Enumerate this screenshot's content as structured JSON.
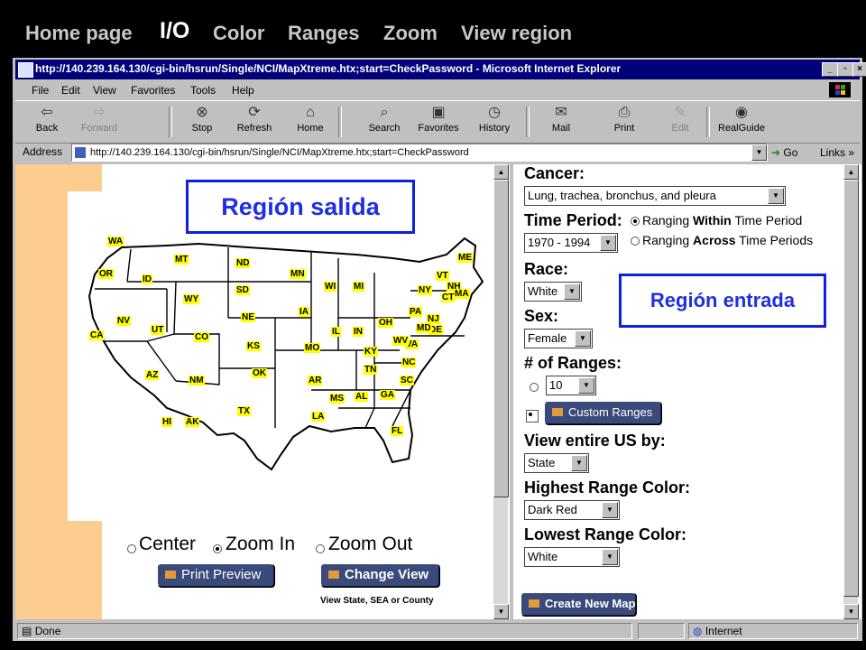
{
  "nav": {
    "items": [
      "Home page",
      "I/O",
      "Color",
      "Ranges",
      "Zoom",
      "View region"
    ],
    "active": "I/O"
  },
  "browser": {
    "title": "http://140.239.164.130/cgi-bin/hsrun/Single/NCI/MapXtreme.htx;start=CheckPassword - Microsoft Internet Explorer",
    "menu": [
      "File",
      "Edit",
      "View",
      "Favorites",
      "Tools",
      "Help"
    ],
    "toolbar": [
      {
        "label": "Back",
        "icon": "back-arrow-icon",
        "glyph": "⇦",
        "enabled": true
      },
      {
        "label": "Forward",
        "icon": "forward-arrow-icon",
        "glyph": "⇨",
        "enabled": false
      },
      {
        "label": "Stop",
        "icon": "stop-icon",
        "glyph": "⊗",
        "enabled": true
      },
      {
        "label": "Refresh",
        "icon": "refresh-icon",
        "glyph": "⟳",
        "enabled": true
      },
      {
        "label": "Home",
        "icon": "home-icon",
        "glyph": "⌂",
        "enabled": true
      },
      {
        "label": "Search",
        "icon": "search-icon",
        "glyph": "⌕",
        "enabled": true
      },
      {
        "label": "Favorites",
        "icon": "favorites-icon",
        "glyph": "▣",
        "enabled": true
      },
      {
        "label": "History",
        "icon": "history-icon",
        "glyph": "◷",
        "enabled": true
      },
      {
        "label": "Mail",
        "icon": "mail-icon",
        "glyph": "✉",
        "enabled": true
      },
      {
        "label": "Print",
        "icon": "print-icon",
        "glyph": "⎙",
        "enabled": true
      },
      {
        "label": "Edit",
        "icon": "edit-icon",
        "glyph": "✎",
        "enabled": false
      },
      {
        "label": "RealGuide",
        "icon": "realguide-icon",
        "glyph": "◉",
        "enabled": true
      }
    ],
    "address_label": "Address",
    "address": "http://140.239.164.130/cgi-bin/hsrun/Single/NCI/MapXtreme.htx;start=CheckPassword",
    "go_label": "Go",
    "links_label": "Links",
    "status_text": "Done",
    "zone_text": "Internet"
  },
  "map": {
    "states": [
      "WA",
      "OR",
      "CA",
      "ID",
      "NV",
      "MT",
      "WY",
      "UT",
      "AZ",
      "CO",
      "NM",
      "ND",
      "SD",
      "NE",
      "KS",
      "OK",
      "TX",
      "MN",
      "IA",
      "MO",
      "AR",
      "LA",
      "WI",
      "IL",
      "MS",
      "MI",
      "IN",
      "KY",
      "TN",
      "AL",
      "OH",
      "GA",
      "FL",
      "SC",
      "NC",
      "VA",
      "WV",
      "PA",
      "NY",
      "VT",
      "ME",
      "NH",
      "MA",
      "CT",
      "NJ",
      "DE",
      "MD",
      "HI",
      "AK"
    ],
    "zoom_options": [
      "Center",
      "Zoom In",
      "Zoom Out"
    ],
    "zoom_selected": "Zoom In",
    "print_preview": "Print Preview",
    "change_view": "Change View",
    "view_note": "View State, SEA or County"
  },
  "form": {
    "cancer_label": "Cancer:",
    "cancer_value": "Lung, trachea, bronchus, and pleura",
    "time_period_label": "Time Period:",
    "time_period_value": "1970 - 1994",
    "time_opt1": [
      "Ranging ",
      "Within",
      " Time Period"
    ],
    "time_opt2": [
      "Ranging ",
      "Across",
      " Time Periods"
    ],
    "race_label": "Race:",
    "race_value": "White",
    "sex_label": "Sex:",
    "sex_value": "Female",
    "ranges_label": "# of Ranges:",
    "ranges_value": "10",
    "custom_ranges": "Custom Ranges",
    "view_by_label": "View entire US by:",
    "view_by_value": "State",
    "highest_label": "Highest Range Color:",
    "highest_value": "Dark Red",
    "lowest_label": "Lowest Range Color:",
    "lowest_value": "White",
    "create_map": "Create New Map"
  },
  "callouts": {
    "output": "Región salida",
    "input": "Región entrada"
  },
  "colors": {
    "accent_blue": "#1020e0",
    "strip_orange": "#fdcd8f",
    "state_label_yellow": "#ffff00",
    "titlebar": "#00007b"
  }
}
